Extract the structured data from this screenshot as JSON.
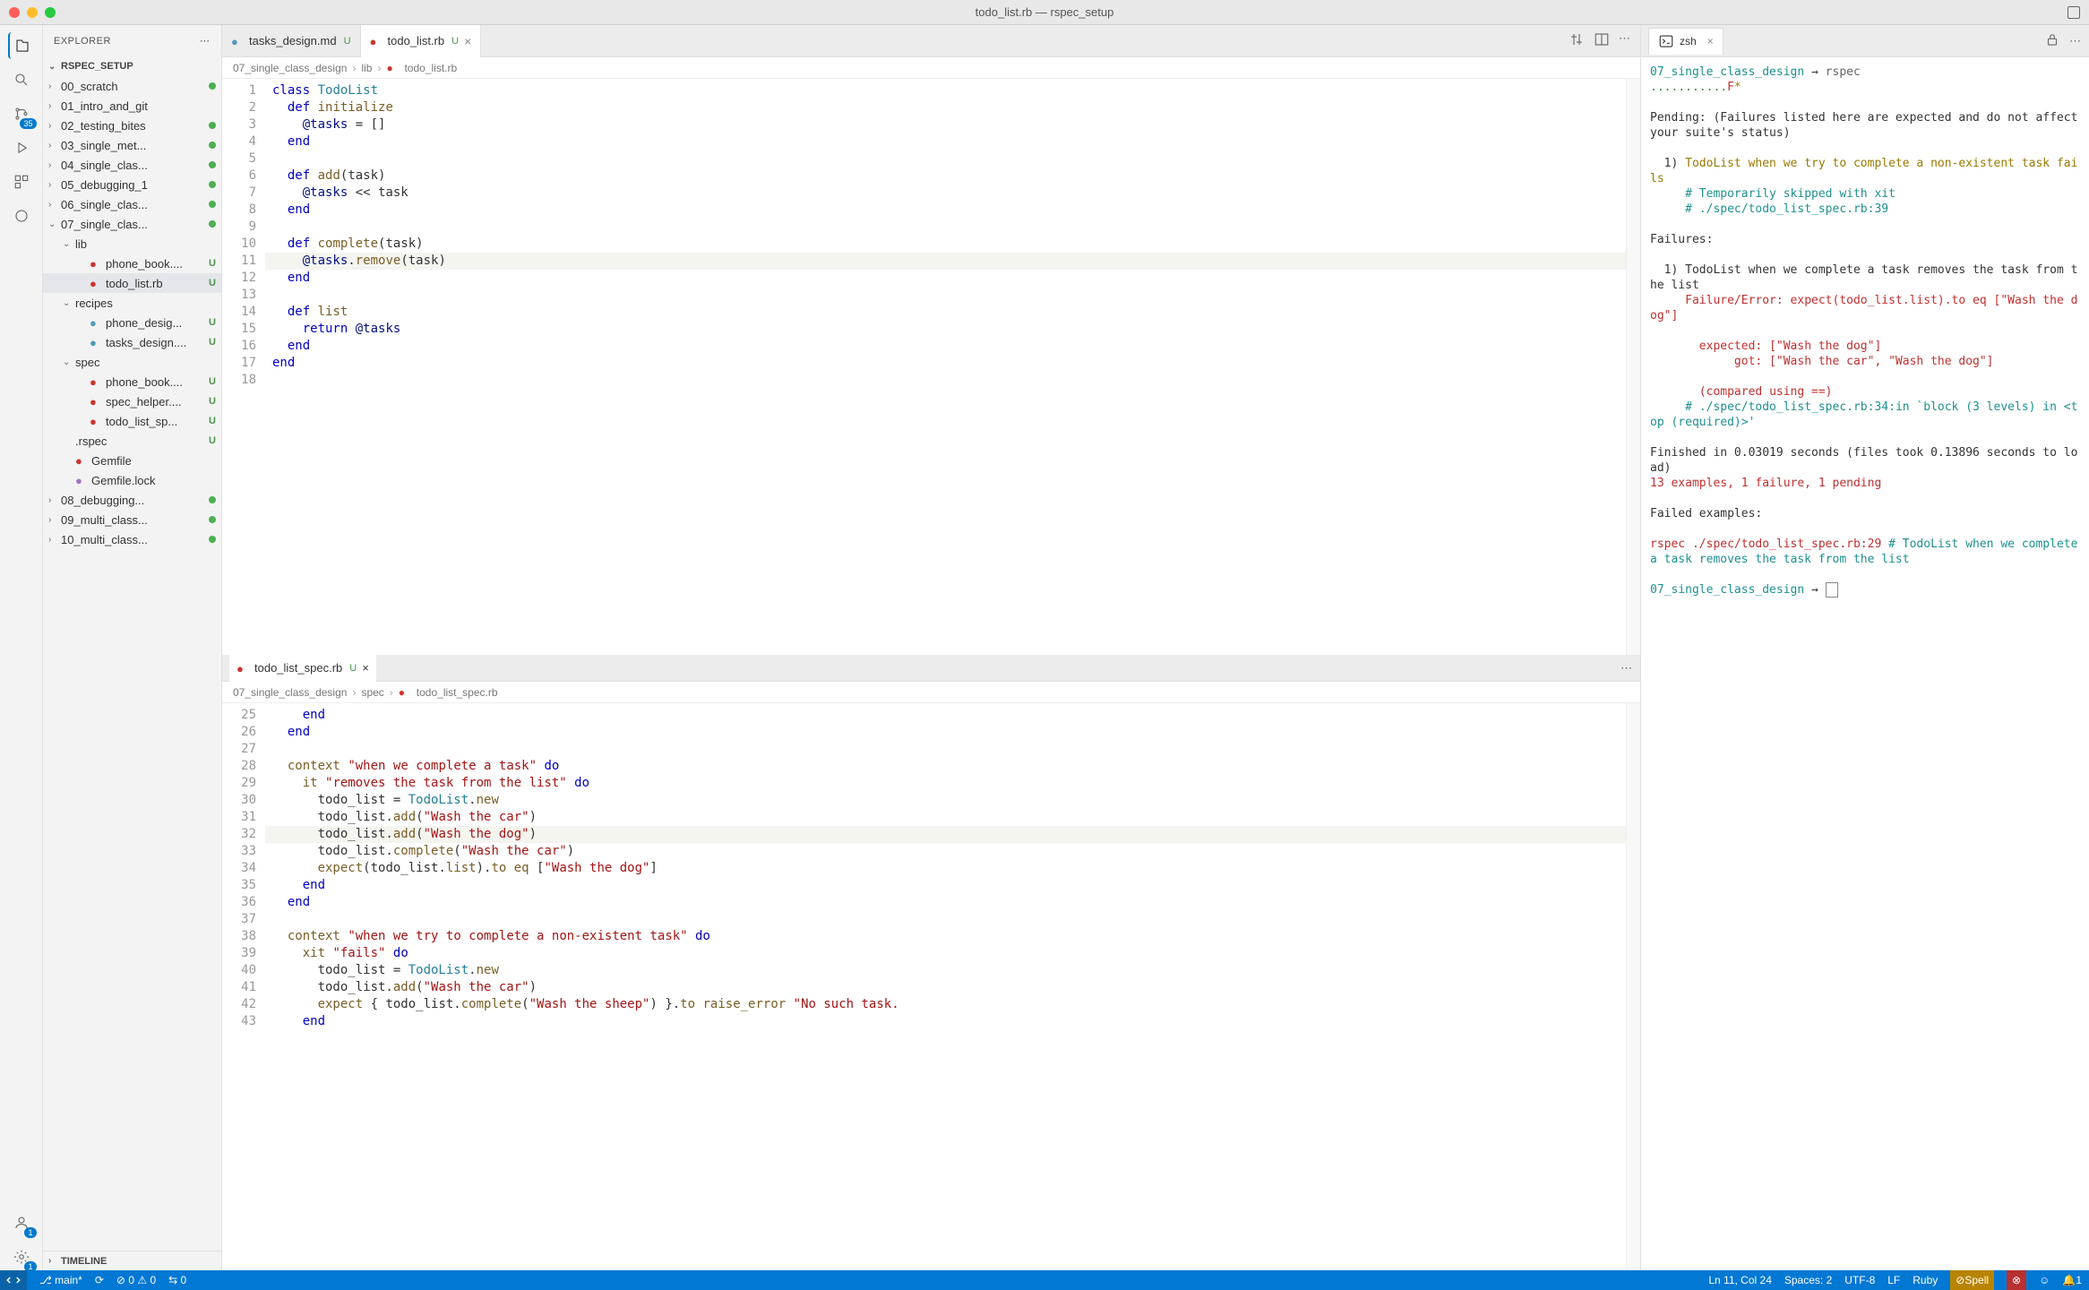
{
  "window_title": "todo_list.rb — rspec_setup",
  "sidebar": {
    "header": "EXPLORER",
    "section": "RSPEC_SETUP",
    "timeline": "TIMELINE",
    "items": [
      {
        "label": "00_scratch",
        "type": "folder",
        "open": false,
        "status": "dot"
      },
      {
        "label": "01_intro_and_git",
        "type": "folder",
        "open": false,
        "status": ""
      },
      {
        "label": "02_testing_bites",
        "type": "folder",
        "open": false,
        "status": "dot"
      },
      {
        "label": "03_single_met...",
        "type": "folder",
        "open": false,
        "status": "dot"
      },
      {
        "label": "04_single_clas...",
        "type": "folder",
        "open": false,
        "status": "dot"
      },
      {
        "label": "05_debugging_1",
        "type": "folder",
        "open": false,
        "status": "dot"
      },
      {
        "label": "06_single_clas...",
        "type": "folder",
        "open": false,
        "status": "dot"
      },
      {
        "label": "07_single_clas...",
        "type": "folder",
        "open": true,
        "status": "dot"
      },
      {
        "label": "lib",
        "type": "folder",
        "open": true,
        "indent": 2,
        "status": ""
      },
      {
        "label": "phone_book....",
        "type": "ruby",
        "indent": 3,
        "status": "U"
      },
      {
        "label": "todo_list.rb",
        "type": "ruby",
        "indent": 3,
        "status": "U",
        "selected": true
      },
      {
        "label": "recipes",
        "type": "folder",
        "open": true,
        "indent": 2,
        "status": ""
      },
      {
        "label": "phone_desig...",
        "type": "md",
        "indent": 3,
        "status": "U"
      },
      {
        "label": "tasks_design....",
        "type": "md",
        "indent": 3,
        "status": "U"
      },
      {
        "label": "spec",
        "type": "folder",
        "open": true,
        "indent": 2,
        "status": ""
      },
      {
        "label": "phone_book....",
        "type": "ruby",
        "indent": 3,
        "status": "U"
      },
      {
        "label": "spec_helper....",
        "type": "ruby",
        "indent": 3,
        "status": "U"
      },
      {
        "label": "todo_list_sp...",
        "type": "ruby",
        "indent": 3,
        "status": "U"
      },
      {
        "label": ".rspec",
        "type": "file",
        "indent": 2,
        "status": "U"
      },
      {
        "label": "Gemfile",
        "type": "ruby",
        "indent": 2,
        "status": ""
      },
      {
        "label": "Gemfile.lock",
        "type": "yml",
        "indent": 2,
        "status": ""
      },
      {
        "label": "08_debugging...",
        "type": "folder",
        "open": false,
        "status": "dot"
      },
      {
        "label": "09_multi_class...",
        "type": "folder",
        "open": false,
        "status": "dot"
      },
      {
        "label": "10_multi_class...",
        "type": "folder",
        "open": false,
        "status": "dot"
      }
    ]
  },
  "tabs": [
    {
      "label": "tasks_design.md",
      "status": "U",
      "active": false,
      "icon": "md"
    },
    {
      "label": "todo_list.rb",
      "status": "U",
      "active": true,
      "icon": "ruby"
    }
  ],
  "breadcrumb_top": [
    "07_single_class_design",
    "lib",
    "todo_list.rb"
  ],
  "breadcrumb_bot": [
    "07_single_class_design",
    "spec",
    "todo_list_spec.rb"
  ],
  "editor_top": {
    "start": 1,
    "lines": [
      {
        "n": 1,
        "html": "<span class='kw'>class</span> <span class='cls'>TodoList</span>"
      },
      {
        "n": 2,
        "html": "  <span class='kw'>def</span> <span class='def'>initialize</span>"
      },
      {
        "n": 3,
        "html": "    <span class='ivar'>@tasks</span> = []"
      },
      {
        "n": 4,
        "html": "  <span class='kw'>end</span>"
      },
      {
        "n": 5,
        "html": ""
      },
      {
        "n": 6,
        "html": "  <span class='kw'>def</span> <span class='def'>add</span>(task)"
      },
      {
        "n": 7,
        "html": "    <span class='ivar'>@tasks</span> &lt;&lt; task"
      },
      {
        "n": 8,
        "html": "  <span class='kw'>end</span>"
      },
      {
        "n": 9,
        "html": ""
      },
      {
        "n": 10,
        "html": "  <span class='kw'>def</span> <span class='def'>complete</span>(task)"
      },
      {
        "n": 11,
        "html": "    <span class='ivar'>@tasks</span>.<span class='def'>remove</span>(task)",
        "hl": true
      },
      {
        "n": 12,
        "html": "  <span class='kw'>end</span>"
      },
      {
        "n": 13,
        "html": ""
      },
      {
        "n": 14,
        "html": "  <span class='kw'>def</span> <span class='def'>list</span>"
      },
      {
        "n": 15,
        "html": "    <span class='kw'>return</span> <span class='ivar'>@tasks</span>"
      },
      {
        "n": 16,
        "html": "  <span class='kw'>end</span>"
      },
      {
        "n": 17,
        "html": "<span class='kw'>end</span>"
      },
      {
        "n": 18,
        "html": ""
      }
    ]
  },
  "pane_bot_tab": {
    "label": "todo_list_spec.rb",
    "status": "U"
  },
  "editor_bot": {
    "lines": [
      {
        "n": 25,
        "html": "    <span class='kw'>end</span>"
      },
      {
        "n": 26,
        "html": "  <span class='kw'>end</span>"
      },
      {
        "n": 27,
        "html": ""
      },
      {
        "n": 28,
        "html": "  <span class='def'>context</span> <span class='str'>\"when we complete a task\"</span> <span class='kw'>do</span>"
      },
      {
        "n": 29,
        "html": "    <span class='def'>it</span> <span class='str'>\"removes the task from the list\"</span> <span class='kw'>do</span>"
      },
      {
        "n": 30,
        "html": "      todo_list = <span class='cls'>TodoList</span>.<span class='def'>new</span>"
      },
      {
        "n": 31,
        "html": "      todo_list.<span class='def'>add</span>(<span class='str'>\"Wash the car\"</span>)"
      },
      {
        "n": 32,
        "html": "      todo_list.<span class='def'>add</span>(<span class='str'>\"Wash the dog\"</span>)",
        "hl": true
      },
      {
        "n": 33,
        "html": "      todo_list.<span class='def'>complete</span>(<span class='str'>\"Wash the car\"</span>)"
      },
      {
        "n": 34,
        "html": "      <span class='def'>expect</span>(todo_list.<span class='def'>list</span>).<span class='def'>to</span> <span class='def'>eq</span> [<span class='str'>\"Wash the dog\"</span>]"
      },
      {
        "n": 35,
        "html": "    <span class='kw'>end</span>"
      },
      {
        "n": 36,
        "html": "  <span class='kw'>end</span>"
      },
      {
        "n": 37,
        "html": ""
      },
      {
        "n": 38,
        "html": "  <span class='def'>context</span> <span class='str'>\"when we try to complete a non-existent task\"</span> <span class='kw'>do</span>"
      },
      {
        "n": 39,
        "html": "    <span class='def'>xit</span> <span class='str'>\"fails\"</span> <span class='kw'>do</span>"
      },
      {
        "n": 40,
        "html": "      todo_list = <span class='cls'>TodoList</span>.<span class='def'>new</span>"
      },
      {
        "n": 41,
        "html": "      todo_list.<span class='def'>add</span>(<span class='str'>\"Wash the car\"</span>)"
      },
      {
        "n": 42,
        "html": "      <span class='def'>expect</span> { todo_list.<span class='def'>complete</span>(<span class='str'>\"Wash the sheep\"</span>) }.<span class='def'>to</span> <span class='def'>raise_error</span> <span class='str'>\"No such task.</span>"
      },
      {
        "n": 43,
        "html": "    <span class='kw'>end</span>"
      }
    ]
  },
  "terminal": {
    "tab": "zsh",
    "lines": [
      {
        "cls": "",
        "html": "<span class='t-cyan'>07_single_class_design</span> → <span class='t-gray'>rspec</span>"
      },
      {
        "cls": "",
        "html": "<span class='t-green'>...........</span><span class='t-red'>F</span><span class='t-yellow'>*</span>"
      },
      {
        "cls": "",
        "html": ""
      },
      {
        "cls": "",
        "html": "Pending: (Failures listed here are expected and do not affect your suite's status)"
      },
      {
        "cls": "",
        "html": ""
      },
      {
        "cls": "",
        "html": "  1) <span class='t-yellow'>TodoList when we try to complete a non-existent task fails</span>"
      },
      {
        "cls": "",
        "html": "     <span class='t-cyan'># Temporarily skipped with xit</span>"
      },
      {
        "cls": "",
        "html": "     <span class='t-cyan'># ./spec/todo_list_spec.rb:39</span>"
      },
      {
        "cls": "",
        "html": ""
      },
      {
        "cls": "",
        "html": "Failures:"
      },
      {
        "cls": "",
        "html": ""
      },
      {
        "cls": "",
        "html": "  1) TodoList when we complete a task removes the task from the list"
      },
      {
        "cls": "",
        "html": "     <span class='t-red'>Failure/Error: expect(todo_list.list).to eq [\"Wash the dog\"]</span>"
      },
      {
        "cls": "",
        "html": ""
      },
      {
        "cls": "",
        "html": "       <span class='t-red'>expected: [\"Wash the dog\"]</span>"
      },
      {
        "cls": "",
        "html": "            <span class='t-red'>got: [\"Wash the car\", \"Wash the dog\"]</span>"
      },
      {
        "cls": "",
        "html": ""
      },
      {
        "cls": "",
        "html": "       <span class='t-red'>(compared using ==)</span>"
      },
      {
        "cls": "",
        "html": "     <span class='t-cyan'># ./spec/todo_list_spec.rb:34:in `block (3 levels) in &lt;top (required)&gt;'</span>"
      },
      {
        "cls": "",
        "html": ""
      },
      {
        "cls": "",
        "html": "Finished in 0.03019 seconds (files took 0.13896 seconds to load)"
      },
      {
        "cls": "",
        "html": "<span class='t-red'>13 examples, 1 failure, 1 pending</span>"
      },
      {
        "cls": "",
        "html": ""
      },
      {
        "cls": "",
        "html": "Failed examples:"
      },
      {
        "cls": "",
        "html": ""
      },
      {
        "cls": "",
        "html": "<span class='t-red'>rspec ./spec/todo_list_spec.rb:29</span> <span class='t-cyan'># TodoList when we complete a task removes the task from the list</span>"
      },
      {
        "cls": "",
        "html": ""
      },
      {
        "cls": "",
        "html": "<span class='t-cyan'>07_single_class_design</span> → <span style='border:1px solid #888;padding:0 2px;'>&nbsp;</span>"
      }
    ]
  },
  "statusbar": {
    "branch": "main*",
    "errors": "0",
    "warnings": "0",
    "port": "0",
    "cursor": "Ln 11, Col 24",
    "spaces": "Spaces: 2",
    "encoding": "UTF-8",
    "eol": "LF",
    "lang": "Ruby",
    "spell": "Spell",
    "notif": "1"
  }
}
